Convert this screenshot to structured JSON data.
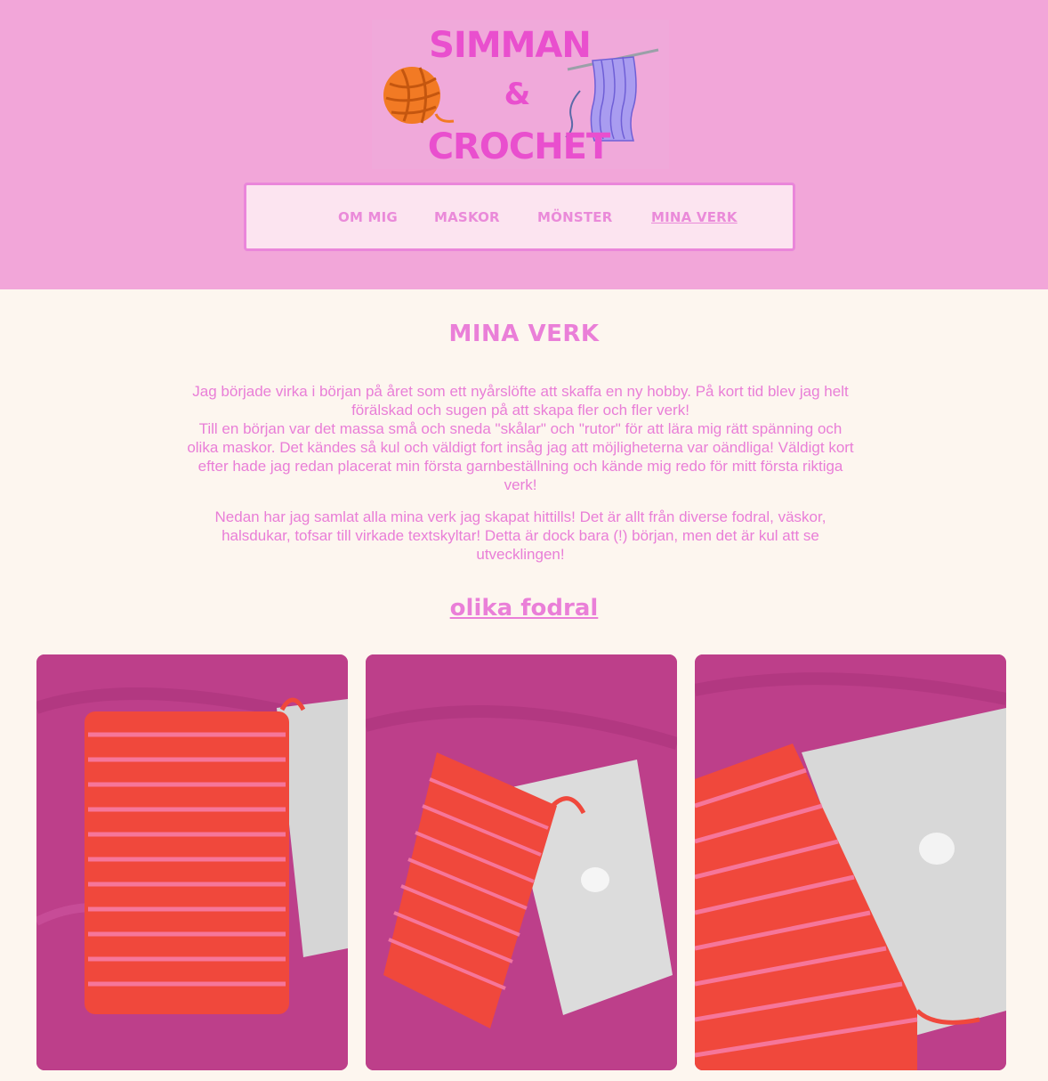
{
  "logo": {
    "line1": "SIMMAN",
    "line2": "&",
    "line3": "CROCHET"
  },
  "nav": {
    "items": [
      {
        "label": "OM MIG"
      },
      {
        "label": "MASKOR"
      },
      {
        "label": "MÖNSTER"
      },
      {
        "label": "MINA VERK",
        "active": true
      }
    ]
  },
  "main": {
    "title": "MINA VERK",
    "paragraph1": "Jag började virka i början på året som ett nyårslöfte att skaffa en ny hobby. På kort tid blev jag helt förälskad och sugen på att skapa fler och fler verk!\nTill en början var det massa små och sneda \"skålar\" och \"rutor\" för att lära mig rätt spänning och olika maskor. Det kändes så kul och väldigt fort insåg jag att möjligheterna var oändliga! Väldigt kort efter hade jag redan placerat min första garnbeställning och kände mig redo för mitt första riktiga verk!",
    "paragraph2": "Nedan har jag samlat alla mina verk jag skapat hittills! Det är allt från diverse fodral, väskor, halsdukar, tofsar till virkade textskyltar! Detta är dock bara (!) början, men det är kul att se utvecklingen!",
    "section_title": "olika fodral"
  },
  "colors": {
    "header_bg": "#f2a6d9",
    "page_bg": "#fdf6ef",
    "accent_text": "#ea7fd8",
    "logo_text": "#e94fce",
    "nav_bg": "#fce4f0"
  }
}
